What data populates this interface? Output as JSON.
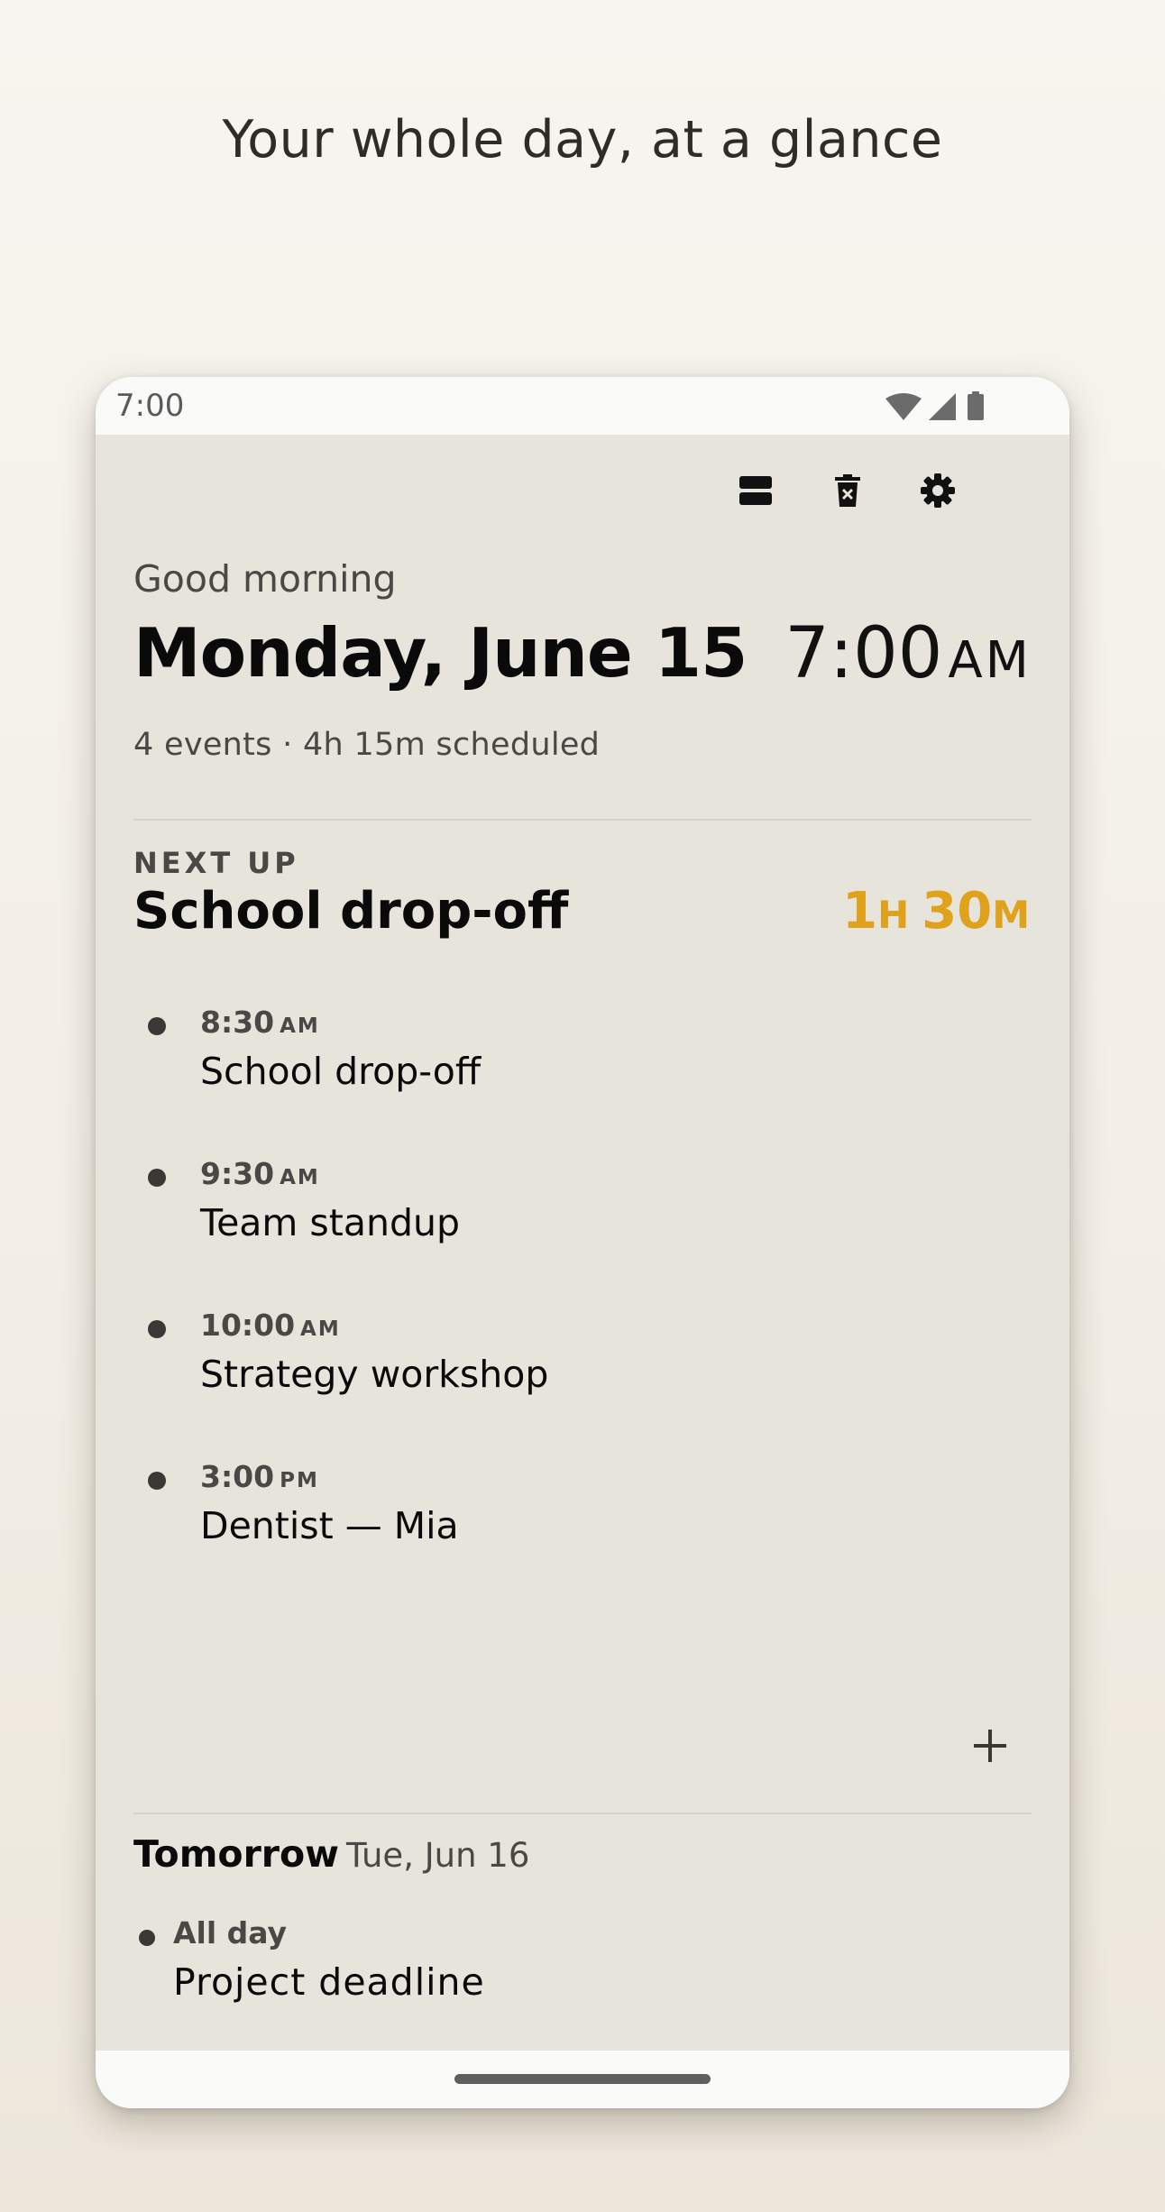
{
  "promo": {
    "heading": "Your whole day, at a glance"
  },
  "status_bar": {
    "time": "7:00",
    "icons": [
      "wifi-icon",
      "signal-icon",
      "battery-icon"
    ]
  },
  "toolbar": {
    "icons": [
      "view-toggle-icon",
      "delete-icon",
      "settings-icon"
    ]
  },
  "header": {
    "greeting": "Good morning",
    "date": "Monday, June 15",
    "clock_time": "7:00",
    "clock_ampm": "AM",
    "summary": "4 events · 4h 15m scheduled"
  },
  "next_up": {
    "label": "NEXT UP",
    "title": "School drop-off",
    "countdown_hours": "1",
    "countdown_hours_unit": "H",
    "countdown_minutes": "30",
    "countdown_minutes_unit": "M"
  },
  "events": [
    {
      "time": "8:30",
      "ampm": "AM",
      "title": "School drop-off"
    },
    {
      "time": "9:30",
      "ampm": "AM",
      "title": "Team standup"
    },
    {
      "time": "10:00",
      "ampm": "AM",
      "title": "Strategy workshop"
    },
    {
      "time": "3:00",
      "ampm": "PM",
      "title": "Dentist — Mia"
    }
  ],
  "add_button": {
    "icon": "plus-icon"
  },
  "tomorrow": {
    "label": "Tomorrow",
    "date": "Tue, Jun 16",
    "events": [
      {
        "time": "All day",
        "title": "Project deadline"
      }
    ]
  },
  "colors": {
    "accent": "#e0a21d",
    "card_background": "#e7e4dc",
    "page_background": "#f5f2eb"
  }
}
